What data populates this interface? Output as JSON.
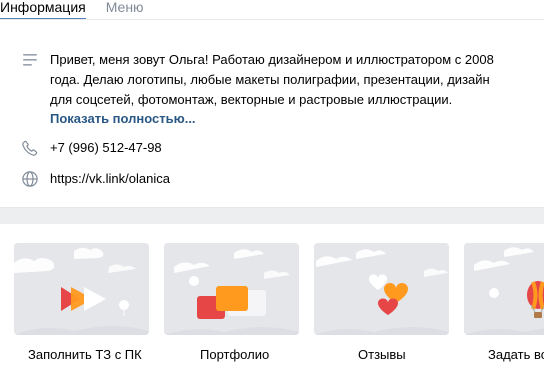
{
  "tabs": [
    {
      "label": "Информация",
      "active": true
    },
    {
      "label": "Меню",
      "active": false
    }
  ],
  "info": {
    "about": "Привет, меня зовут Ольга! Работаю дизайнером и иллюстратором с 2008 года. Делаю логотипы, любые макеты полиграфии, презентации, дизайн для соцсетей, фотомонтаж, векторные и растровые иллюстрации.",
    "show_more": "Показать полностью...",
    "phone": "+7 (996) 512-47-98",
    "link": "https://vk.link/olanica",
    "icons": {
      "about": "text-lines-icon",
      "phone": "phone-icon",
      "link": "globe-icon"
    }
  },
  "cards": [
    {
      "label": "Заполнить ТЗ с ПК",
      "icon": "play-arrows-icon"
    },
    {
      "label": "Портфолио",
      "icon": "stacked-cards-icon"
    },
    {
      "label": "Отзывы",
      "icon": "hearts-icon"
    },
    {
      "label": "Задать во",
      "icon": "hot-air-balloon-icon"
    }
  ],
  "colors": {
    "accent": "#5181b8",
    "link": "#2a5885",
    "orange": "#ff9a1f",
    "red": "#e64646"
  }
}
